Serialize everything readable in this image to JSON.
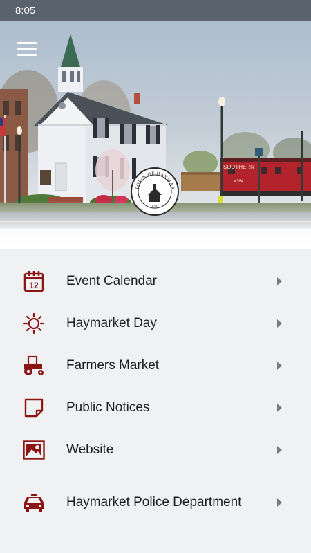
{
  "status_bar": {
    "time": "8:05"
  },
  "header": {
    "menu_icon": "hamburger-menu-icon",
    "seal_text": "TOWN OF HAYMARKET VIRGINIA",
    "seal_year": "1799",
    "caboose_text": "SOUTHERN",
    "caboose_number": "X384"
  },
  "theme": {
    "accent": "#8b1414",
    "status_bar": "#5a626e",
    "background": "#f0f1f3"
  },
  "menu": {
    "items": [
      {
        "label": "Event Calendar",
        "icon": "calendar-icon",
        "calendar_day": "12"
      },
      {
        "label": "Haymarket Day",
        "icon": "sun-icon"
      },
      {
        "label": "Farmers Market",
        "icon": "tractor-icon"
      },
      {
        "label": "Public Notices",
        "icon": "note-icon"
      },
      {
        "label": "Website",
        "icon": "image-icon"
      },
      {
        "label": "Haymarket Police Department",
        "icon": "police-car-icon"
      }
    ]
  }
}
